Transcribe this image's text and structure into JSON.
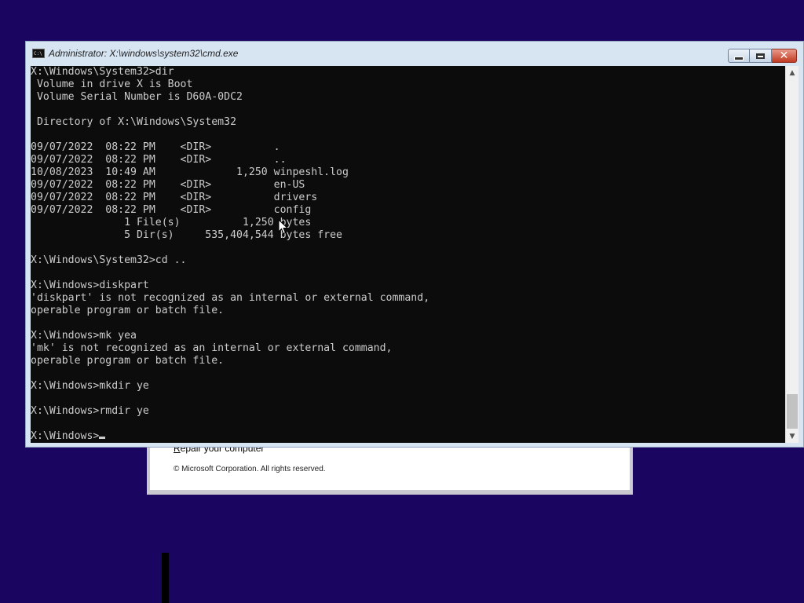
{
  "background": {
    "color": "#1a0560",
    "dialog": {
      "repair_link": "Repair your computer",
      "copyright": "© Microsoft Corporation. All rights reserved."
    }
  },
  "window": {
    "title": "Administrator: X:\\windows\\system32\\cmd.exe",
    "icon": "cmd-icon",
    "icon_text": "C:\\",
    "buttons": {
      "minimize": "minimize-icon",
      "maximize": "maximize-icon",
      "close": "close-icon",
      "close_glyph": "✕"
    }
  },
  "console": {
    "lines": [
      "X:\\Windows\\System32>dir",
      " Volume in drive X is Boot",
      " Volume Serial Number is D60A-0DC2",
      "",
      " Directory of X:\\Windows\\System32",
      "",
      "09/07/2022  08:22 PM    <DIR>          .",
      "09/07/2022  08:22 PM    <DIR>          ..",
      "10/08/2023  10:49 AM             1,250 winpeshl.log",
      "09/07/2022  08:22 PM    <DIR>          en-US",
      "09/07/2022  08:22 PM    <DIR>          drivers",
      "09/07/2022  08:22 PM    <DIR>          config",
      "               1 File(s)          1,250 bytes",
      "               5 Dir(s)     535,404,544 bytes free",
      "",
      "X:\\Windows\\System32>cd ..",
      "",
      "X:\\Windows>diskpart",
      "'diskpart' is not recognized as an internal or external command,",
      "operable program or batch file.",
      "",
      "X:\\Windows>mk yea",
      "'mk' is not recognized as an internal or external command,",
      "operable program or batch file.",
      "",
      "X:\\Windows>mkdir ye",
      "",
      "X:\\Windows>rmdir ye",
      ""
    ],
    "prompt": "X:\\Windows>",
    "scroll": {
      "up_glyph": "▲",
      "down_glyph": "▼"
    }
  }
}
